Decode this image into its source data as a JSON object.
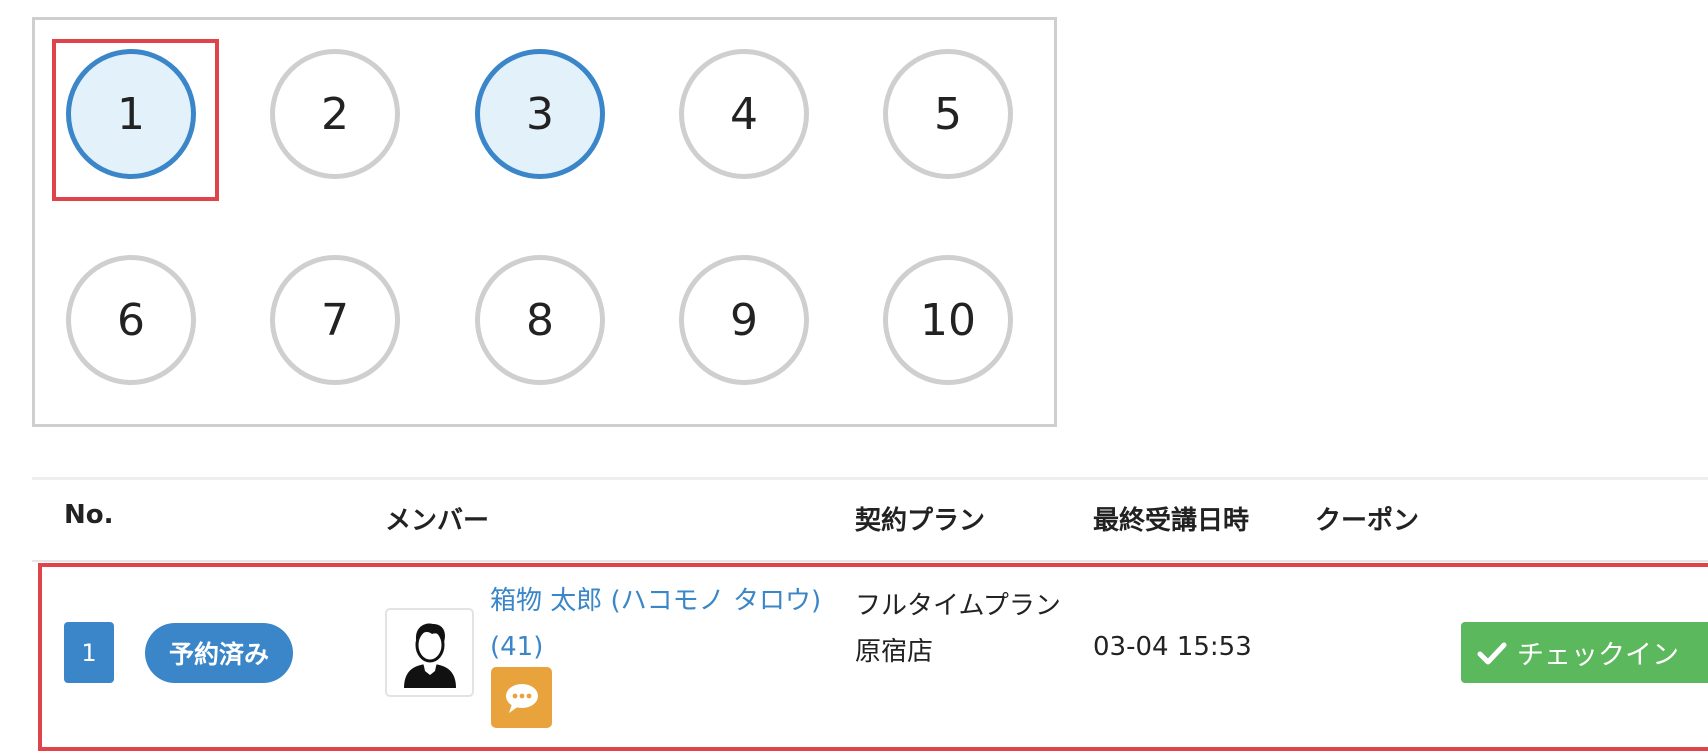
{
  "seats": [
    "1",
    "2",
    "3",
    "4",
    "5",
    "6",
    "7",
    "8",
    "9",
    "10"
  ],
  "selected_seats": [
    "1",
    "3"
  ],
  "table": {
    "headers": {
      "no": "No.",
      "member": "メンバー",
      "plan": "契約プラン",
      "last_attend": "最終受講日時",
      "coupon": "クーポン"
    },
    "rows": [
      {
        "no": "1",
        "status": "予約済み",
        "member_name": "箱物 太郎 (ハコモノ タロウ) (41)",
        "plan": "フルタイムプラン",
        "store": "原宿店",
        "last_attend": "03-04 15:53",
        "action_label": "チェックイン"
      }
    ]
  },
  "colors": {
    "primary": "#3a86c8",
    "selected_fill": "#e3f1fb",
    "highlight": "#e0444b",
    "chat": "#e8a33c",
    "success": "#5cb85c"
  }
}
